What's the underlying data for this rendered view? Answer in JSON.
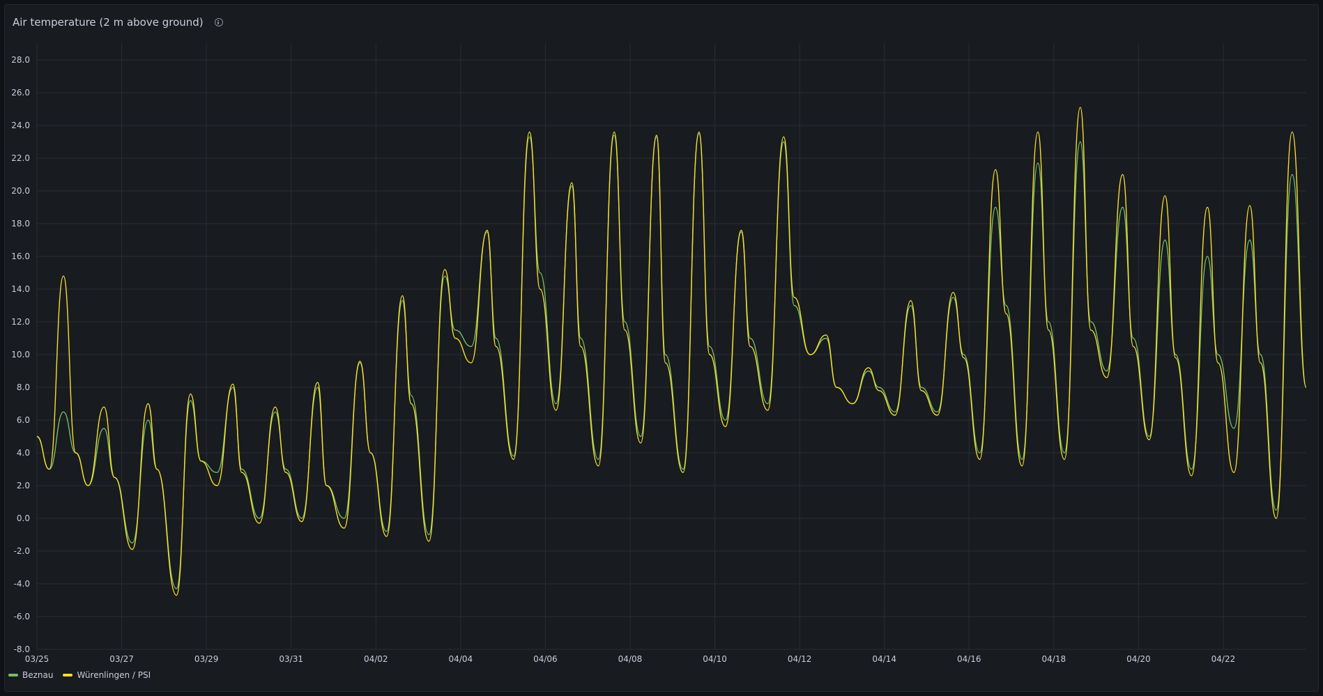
{
  "panel": {
    "title": "Air temperature (2 m above ground)",
    "info_icon": "info-circle-icon"
  },
  "colors": {
    "background": "#181b1f",
    "grid": "#2a2d33",
    "axis_text": "#ccccdc",
    "beznau": "#73bf69",
    "wurenlingen": "#fade2a"
  },
  "legend": {
    "items": [
      {
        "label": "Beznau",
        "color": "#73bf69"
      },
      {
        "label": "Würenlingen / PSI",
        "color": "#fade2a"
      }
    ]
  },
  "chart_data": {
    "type": "line",
    "title": "Air temperature (2 m above ground)",
    "xlabel": "",
    "ylabel": "",
    "ylim": [
      -8.0,
      28.0
    ],
    "yticks": [
      "28.0",
      "26.0",
      "24.0",
      "22.0",
      "20.0",
      "18.0",
      "16.0",
      "14.0",
      "12.0",
      "10.0",
      "8.0",
      "6.0",
      "4.0",
      "2.0",
      "0.0",
      "-2.0",
      "-4.0",
      "-6.0",
      "-8.0"
    ],
    "xlim": [
      "03/25 00:00",
      "04/23 23:00"
    ],
    "xticks": [
      "03/25",
      "03/27",
      "03/29",
      "03/31",
      "04/02",
      "04/04",
      "04/06",
      "04/08",
      "04/10",
      "04/12",
      "04/14",
      "04/16",
      "04/18",
      "04/20",
      "04/22"
    ],
    "grid": true,
    "legend_position": "bottom-left",
    "x": [
      "03/25 00:00",
      "03/25 07:00",
      "03/25 15:00",
      "03/25 22:00",
      "03/26 05:00",
      "03/26 14:00",
      "03/26 20:00",
      "03/27 06:00",
      "03/27 15:00",
      "03/27 20:00",
      "03/28 07:00",
      "03/28 15:00",
      "03/28 21:00",
      "03/29 06:00",
      "03/29 15:00",
      "03/29 20:00",
      "03/30 06:00",
      "03/30 15:00",
      "03/30 21:00",
      "03/31 06:00",
      "03/31 15:00",
      "03/31 20:00",
      "04/01 06:00",
      "04/01 15:00",
      "04/01 21:00",
      "04/02 06:00",
      "04/02 15:00",
      "04/02 20:00",
      "04/03 06:00",
      "04/03 15:00",
      "04/03 21:00",
      "04/04 06:00",
      "04/04 15:00",
      "04/04 20:00",
      "04/05 06:00",
      "04/05 15:00",
      "04/05 21:00",
      "04/06 06:00",
      "04/06 15:00",
      "04/06 20:00",
      "04/07 06:00",
      "04/07 15:00",
      "04/07 21:00",
      "04/08 06:00",
      "04/08 15:00",
      "04/08 20:00",
      "04/09 06:00",
      "04/09 15:00",
      "04/09 21:00",
      "04/10 06:00",
      "04/10 15:00",
      "04/10 20:00",
      "04/11 06:00",
      "04/11 15:00",
      "04/11 21:00",
      "04/12 06:00",
      "04/12 15:00",
      "04/12 21:00",
      "04/13 06:00",
      "04/13 15:00",
      "04/13 21:00",
      "04/14 06:00",
      "04/14 15:00",
      "04/14 21:00",
      "04/15 06:00",
      "04/15 15:00",
      "04/15 21:00",
      "04/16 06:00",
      "04/16 15:00",
      "04/16 21:00",
      "04/17 06:00",
      "04/17 15:00",
      "04/17 21:00",
      "04/18 06:00",
      "04/18 15:00",
      "04/18 21:00",
      "04/19 06:00",
      "04/19 15:00",
      "04/19 21:00",
      "04/20 06:00",
      "04/20 15:00",
      "04/20 21:00",
      "04/21 06:00",
      "04/21 15:00",
      "04/21 21:00",
      "04/22 06:00",
      "04/22 15:00",
      "04/22 21:00",
      "04/23 06:00",
      "04/23 15:00",
      "04/23 23:00"
    ],
    "series": [
      {
        "name": "Beznau",
        "color": "#73bf69",
        "values": [
          5.0,
          3.0,
          6.5,
          4.0,
          2.0,
          5.5,
          2.5,
          -1.5,
          6.0,
          3.0,
          -4.3,
          7.2,
          3.5,
          2.8,
          8.0,
          3.0,
          0.0,
          6.5,
          3.0,
          0.0,
          8.0,
          2.0,
          0.0,
          9.5,
          4.0,
          -0.8,
          13.3,
          7.5,
          -1.0,
          14.8,
          11.5,
          10.5,
          17.5,
          11.0,
          3.8,
          23.3,
          15.0,
          7.0,
          20.3,
          11.0,
          3.6,
          23.4,
          12.0,
          5.0,
          23.3,
          10.0,
          3.0,
          23.5,
          10.5,
          6.0,
          17.5,
          11.0,
          7.0,
          23.0,
          13.0,
          10.0,
          11.0,
          8.0,
          7.0,
          9.0,
          8.0,
          6.5,
          13.0,
          8.0,
          6.5,
          13.5,
          10.0,
          4.0,
          19.0,
          13.0,
          3.6,
          21.7,
          12.0,
          4.0,
          23.0,
          12.0,
          9.0,
          19.0,
          11.0,
          5.0,
          17.0,
          10.0,
          3.0,
          16.0,
          10.0,
          5.5,
          17.0,
          10.0,
          0.5,
          21.0,
          8.0
        ]
      },
      {
        "name": "Würenlingen / PSI",
        "color": "#fade2a",
        "values": [
          5.0,
          3.0,
          14.8,
          4.0,
          2.0,
          6.8,
          2.5,
          -1.9,
          7.0,
          3.0,
          -4.7,
          7.6,
          3.5,
          2.0,
          8.2,
          2.8,
          -0.3,
          6.8,
          2.8,
          -0.2,
          8.3,
          2.0,
          -0.6,
          9.6,
          4.0,
          -1.1,
          13.6,
          7.0,
          -1.4,
          15.2,
          11.0,
          9.5,
          17.6,
          10.5,
          3.6,
          23.6,
          14.0,
          6.6,
          20.5,
          10.5,
          3.2,
          23.6,
          11.5,
          4.6,
          23.4,
          9.5,
          2.8,
          23.6,
          10.0,
          5.6,
          17.6,
          10.5,
          6.6,
          23.3,
          13.5,
          10.0,
          11.2,
          8.0,
          7.0,
          9.2,
          7.8,
          6.3,
          13.3,
          7.8,
          6.3,
          13.8,
          9.8,
          3.6,
          21.3,
          12.5,
          3.2,
          23.6,
          11.5,
          3.6,
          25.1,
          11.5,
          8.6,
          21.0,
          10.5,
          4.8,
          19.7,
          9.8,
          2.6,
          19.0,
          9.5,
          2.8,
          19.1,
          9.5,
          0.0,
          23.6,
          8.0
        ]
      }
    ]
  }
}
